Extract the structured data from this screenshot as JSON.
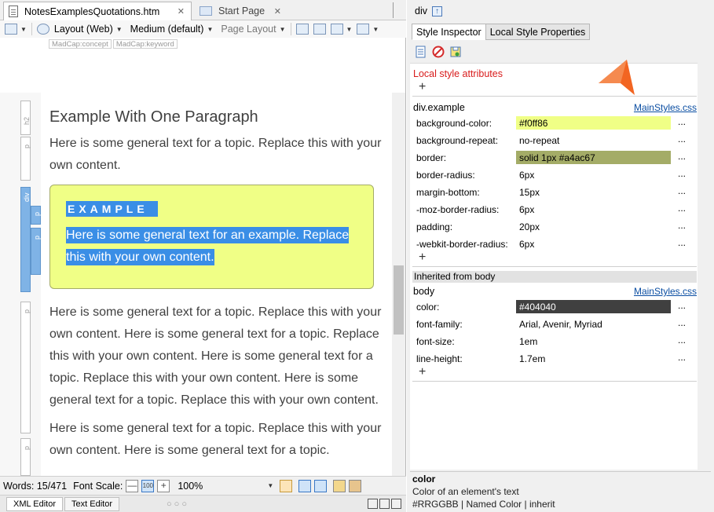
{
  "tabs": [
    {
      "label": "NotesExamplesQuotations.htm",
      "close": "✕"
    },
    {
      "label": "Start Page",
      "close": "✕"
    }
  ],
  "toolbar": {
    "layout": "Layout (Web)",
    "medium": "Medium (default)",
    "page_layout": "Page Layout"
  },
  "tag_labels": [
    "MadCap:concept",
    "MadCap:keyword"
  ],
  "structure_labels": [
    "h2",
    "p",
    "div",
    "p",
    "p",
    "p",
    "p"
  ],
  "document": {
    "heading": "Example With One Paragraph",
    "para1": "Here is some general text for a topic. Replace this with your own content.",
    "example_heading": "EXAMPLE",
    "example_text": "Here is some general text for an example. Replace this with your own content.",
    "para2": "Here is some general text for a topic. Replace this with your own content. Here is some general text for a topic. Replace this with your own content. Here is some general text for a topic. Replace this with your own content. Here is some general text for a topic. Replace this with your own content.",
    "para3": "Here is some general text for a topic. Replace this with your own content. Here is some general text for a topic."
  },
  "status": {
    "words": "Words: 15/471",
    "font_scale_label": "Font Scale:",
    "zoom": "100%",
    "box_100": "100",
    "minus": "—",
    "plus": "+"
  },
  "bottom_tabs": {
    "xml_editor": "XML Editor",
    "text_editor": "Text Editor",
    "dots": "○ ○ ○"
  },
  "right_panel": {
    "element": "div",
    "up_icon": "↑",
    "tabs": [
      "Style Inspector",
      "Local Style Properties"
    ],
    "local_title": "Local style attributes",
    "plus": "+",
    "class_title": "div.example",
    "stylesheet_link": "MainStyles.css",
    "properties": [
      {
        "name": "background-color:",
        "value": "#f0ff86",
        "color": "#f0ff86",
        "dots": "..."
      },
      {
        "name": "background-repeat:",
        "value": "no-repeat",
        "color": "",
        "dots": "..."
      },
      {
        "name": "border:",
        "value": "solid 1px #a4ac67",
        "color": "#a4ac67",
        "dots": "..."
      },
      {
        "name": "border-radius:",
        "value": "6px",
        "color": "",
        "dots": "..."
      },
      {
        "name": "margin-bottom:",
        "value": "15px",
        "color": "",
        "dots": "..."
      },
      {
        "name": "-moz-border-radius:",
        "value": "6px",
        "color": "",
        "dots": "..."
      },
      {
        "name": "padding:",
        "value": "20px",
        "color": "",
        "dots": "..."
      },
      {
        "name": "-webkit-border-radius:",
        "value": "6px",
        "color": "",
        "dots": "..."
      }
    ],
    "inherited_band": "Inherited from body",
    "body_title": "body",
    "inherited": [
      {
        "name": "color:",
        "value": "#404040",
        "color": "#404040",
        "dots": "..."
      },
      {
        "name": "font-family:",
        "value": "Arial, Avenir, Myriad",
        "color": "",
        "dots": "..."
      },
      {
        "name": "font-size:",
        "value": "1em",
        "color": "",
        "dots": "..."
      },
      {
        "name": "line-height:",
        "value": "1.7em",
        "color": "",
        "dots": "..."
      }
    ],
    "help": {
      "title": "color",
      "line1": "Color of an element's text",
      "line2": "#RRGGBB | Named Color | inherit"
    }
  },
  "colors": {
    "example_bg": "#f0ff86",
    "example_border": "#a4ac67",
    "selection": "#3a8ee6",
    "arrow": "#f26522"
  }
}
